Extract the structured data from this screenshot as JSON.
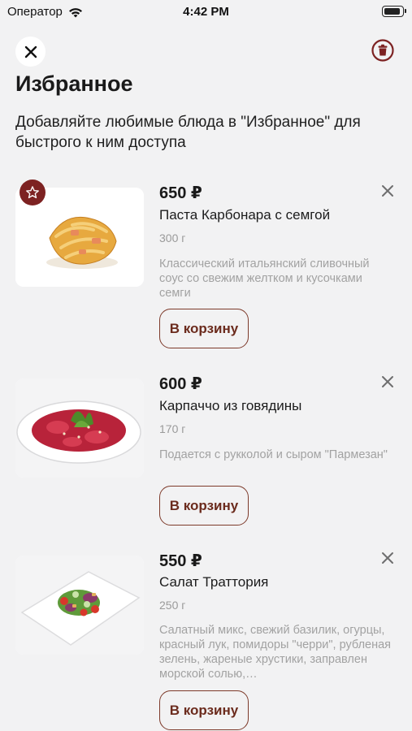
{
  "status_bar": {
    "carrier": "Оператор",
    "time": "4:42 PM",
    "battery_level": 0.95
  },
  "header": {
    "title": "Избранное",
    "subtitle": "Добавляйте любимые блюда в \"Избранное\" для быстрого к ним доступа",
    "close_icon": "close-icon",
    "trash_icon": "trash-icon"
  },
  "items": [
    {
      "price": "650 ₽",
      "name": "Паста Карбонара с семгой",
      "weight": "300 г",
      "description": "Классический итальянский сливочный соус со свежим желтком и кусочками семги",
      "cart_label": "В корзину",
      "favorite": true
    },
    {
      "price": "600 ₽",
      "name": "Карпаччо из говядины",
      "weight": "170 г",
      "description": "Подается с рукколой и сыром \"Пармезан\"",
      "cart_label": "В корзину",
      "favorite": false
    },
    {
      "price": "550 ₽",
      "name": "Салат Траттория",
      "weight": "250 г",
      "description": "Салатный микс, свежий базилик, огурцы, красный лук, помидоры \"черри\", рубленая зелень, жареные хрустики, заправлен морской солью,…",
      "cart_label": "В корзину",
      "favorite": false
    }
  ],
  "colors": {
    "accent": "#7d2222",
    "button_text": "#6b2b1d",
    "background": "#f2f2f3",
    "muted_text": "#a2a2a2"
  }
}
